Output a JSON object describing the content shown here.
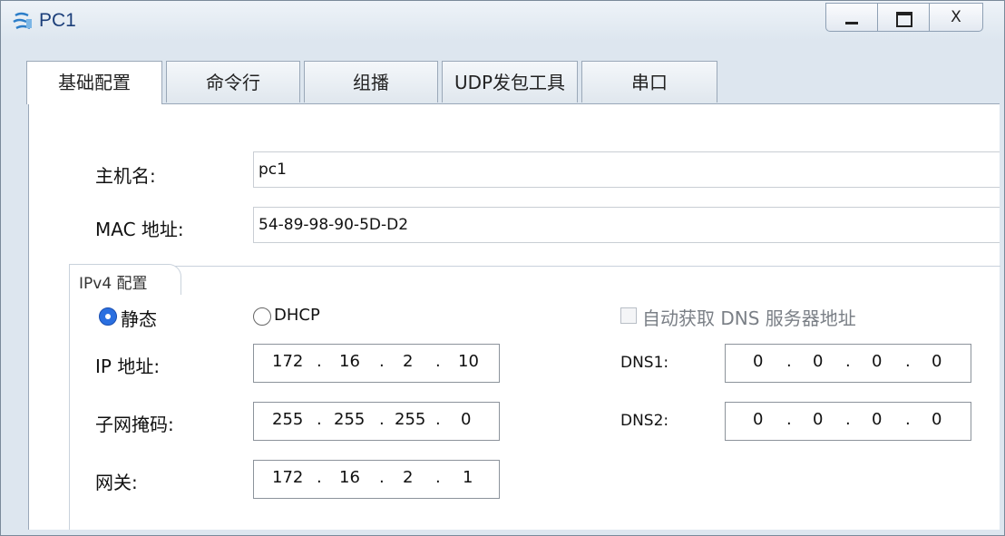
{
  "window": {
    "title": "PC1",
    "minimize_icon": "minimize-icon",
    "maximize_icon": "maximize-icon",
    "close_label": "X"
  },
  "tabs": [
    {
      "label": "基础配置",
      "active": true
    },
    {
      "label": "命令行",
      "active": false
    },
    {
      "label": "组播",
      "active": false
    },
    {
      "label": "UDP发包工具",
      "active": false
    },
    {
      "label": "串口",
      "active": false
    }
  ],
  "basic": {
    "hostname_label": "主机名:",
    "hostname_value": "pc1",
    "mac_label": "MAC 地址:",
    "mac_value": "54-89-98-90-5D-D2"
  },
  "ipv4": {
    "group_title": "IPv4 配置",
    "static_label": "静态",
    "dhcp_label": "DHCP",
    "mode_selected": "静态",
    "auto_dns_label": "自动获取 DNS 服务器地址",
    "auto_dns_checked": false,
    "ip_label": "IP 地址:",
    "ip": [
      "172",
      "16",
      "2",
      "10"
    ],
    "mask_label": "子网掩码:",
    "mask": [
      "255",
      "255",
      "255",
      "0"
    ],
    "gateway_label": "网关:",
    "gateway": [
      "172",
      "16",
      "2",
      "1"
    ],
    "dns1_label": "DNS1:",
    "dns1": [
      "0",
      "0",
      "0",
      "0"
    ],
    "dns2_label": "DNS2:",
    "dns2": [
      "0",
      "0",
      "0",
      "0"
    ],
    "dot": "."
  },
  "colors": {
    "accent": "#2a6fe0",
    "title_text": "#1c3f7a",
    "chrome": "#dde6ef"
  }
}
